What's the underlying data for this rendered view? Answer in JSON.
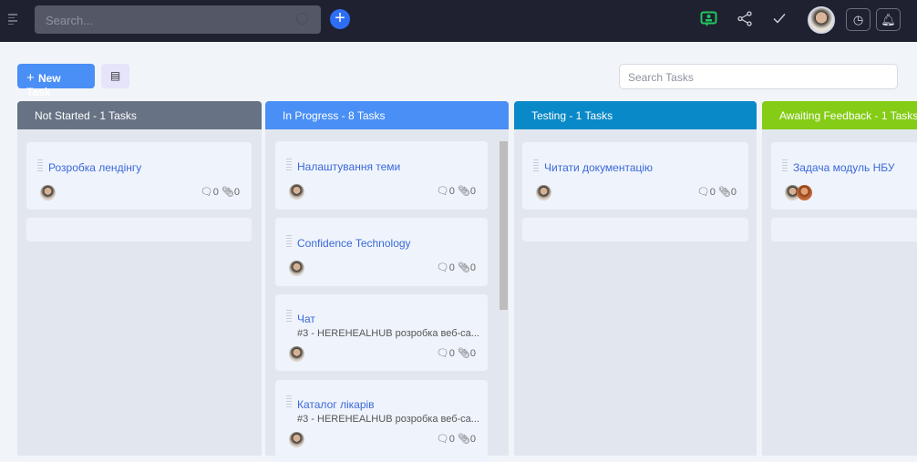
{
  "topbar": {
    "search_placeholder": "Search...",
    "add_icon": "+",
    "icons": [
      "chat-user-icon",
      "share-icon",
      "check-icon",
      "avatar",
      "clock-icon",
      "bell-icon"
    ]
  },
  "toolbar": {
    "new_task_label": "New Task",
    "search_tasks_placeholder": "Search Tasks"
  },
  "columns": [
    {
      "title": "Not Started - 1 Tasks",
      "color": "#677384",
      "cards": [
        {
          "title": "Розробка лендінгу",
          "comments": "0",
          "attachments": "0"
        }
      ]
    },
    {
      "title": "In Progress - 8 Tasks",
      "color": "#4a8ff5",
      "cards": [
        {
          "title": "Налаштування теми",
          "comments": "0",
          "attachments": "0"
        },
        {
          "title": "Confidence Technology",
          "comments": "0",
          "attachments": "0"
        },
        {
          "title": "Чат",
          "subtitle": "#3 - HEREHEALHUB розробка веб-са...",
          "comments": "0",
          "attachments": "0"
        },
        {
          "title": "Каталог лікарів",
          "subtitle": "#3 - HEREHEALHUB розробка веб-са...",
          "comments": "0",
          "attachments": "0"
        }
      ]
    },
    {
      "title": "Testing - 1 Tasks",
      "color": "#0a89c8",
      "cards": [
        {
          "title": "Читати документацію",
          "comments": "0",
          "attachments": "0"
        }
      ]
    },
    {
      "title": "Awaiting Feedback - 1 Tasks",
      "color": "#84cc16",
      "cards": [
        {
          "title": "Задача модуль НБУ"
        }
      ]
    }
  ]
}
